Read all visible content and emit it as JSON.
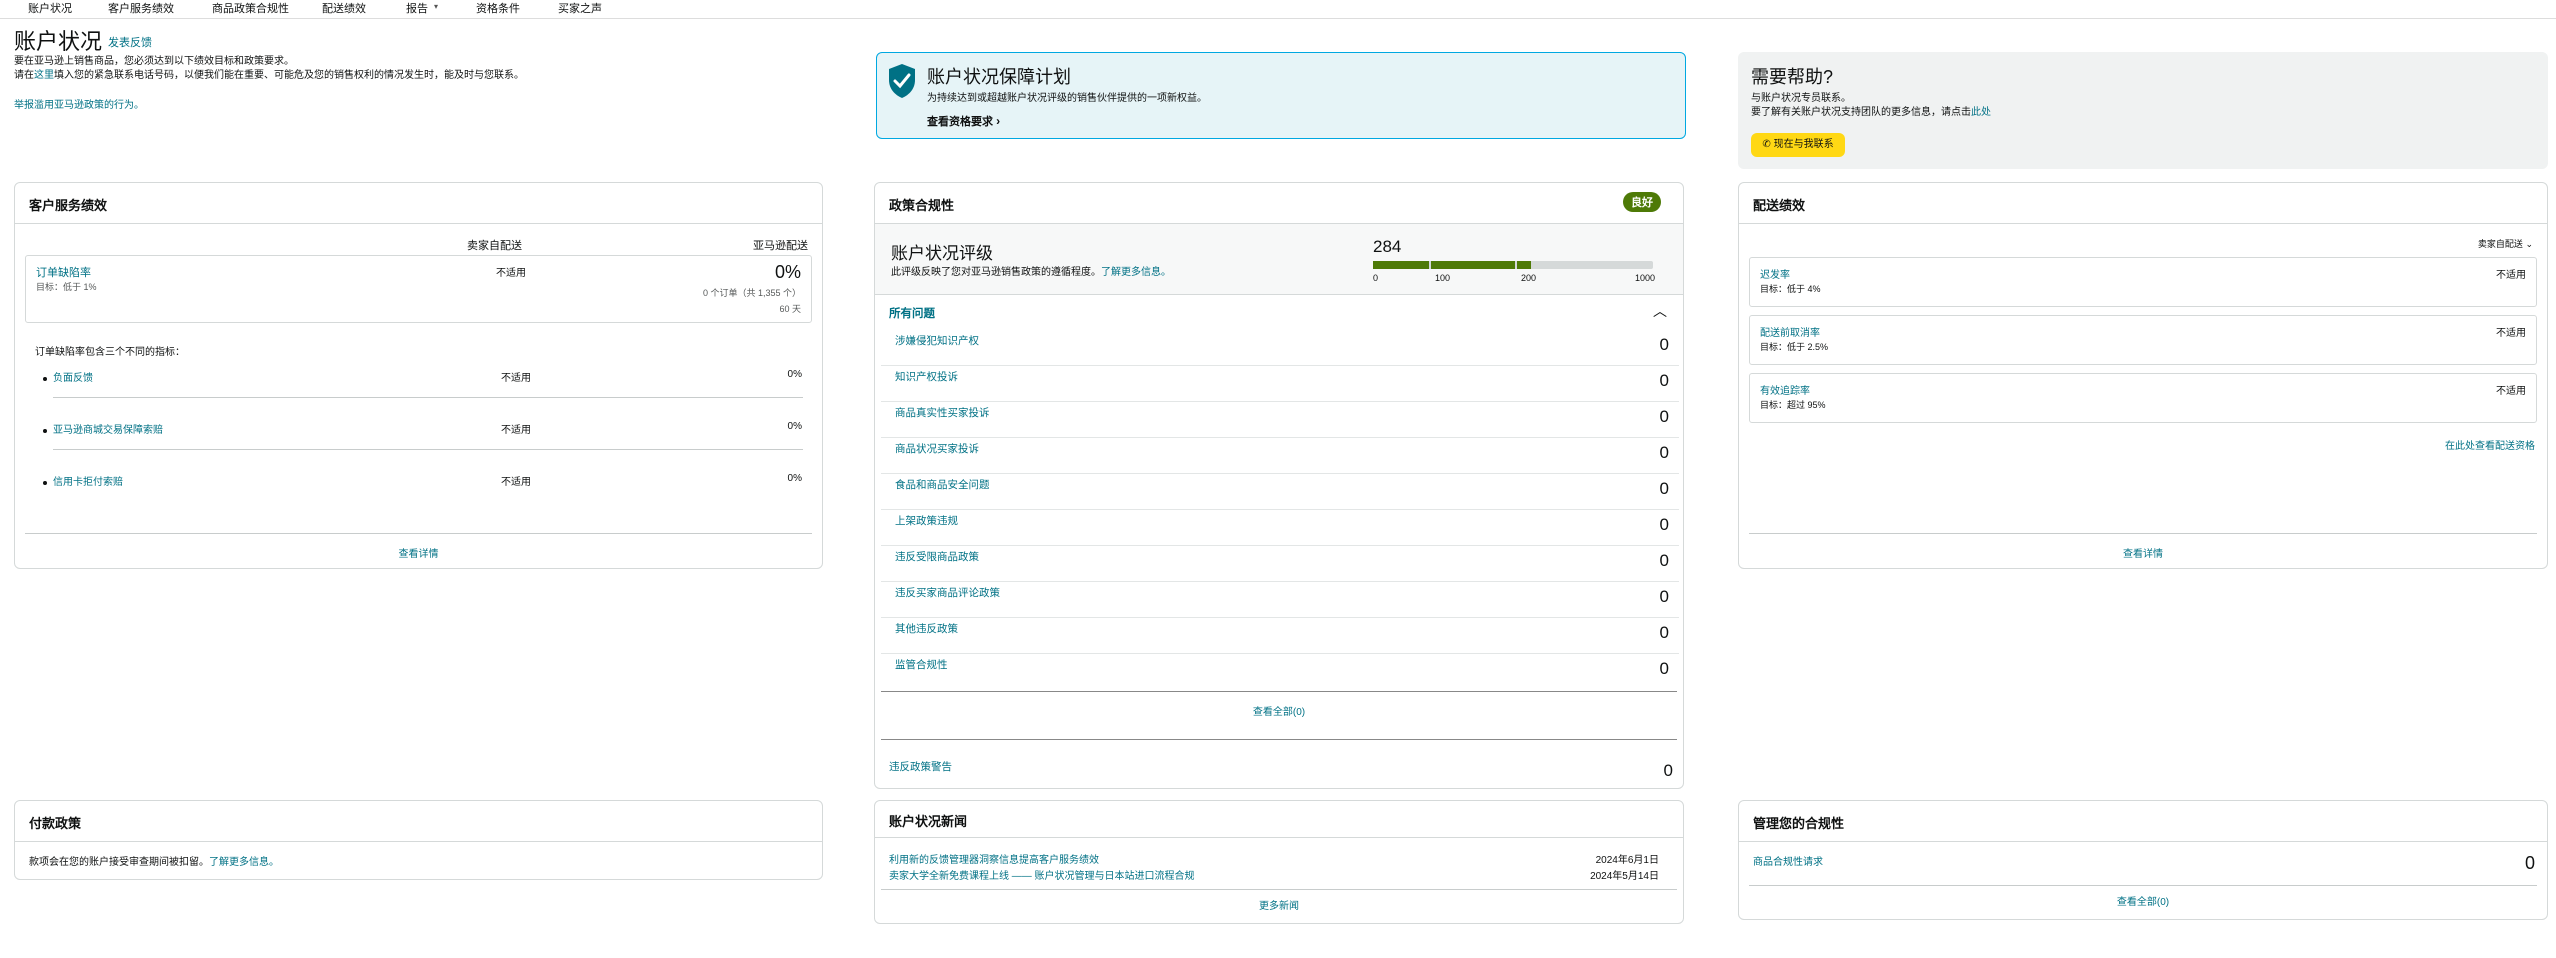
{
  "nav": {
    "items": [
      "账户状况",
      "客户服务绩效",
      "商品政策合规性",
      "配送绩效",
      "报告",
      "资格条件",
      "买家之声"
    ]
  },
  "header": {
    "title": "账户状况",
    "feedback_link": "发表反馈",
    "line1": "要在亚马逊上销售商品，您必须达到以下绩效目标和政策要求。",
    "line2_prefix": "请在",
    "line2_link": "这里",
    "line2_suffix": "填入您的紧急联系电话号码，以便我们能在重要、可能危及您的销售权利的情况发生时，能及时与您联系。",
    "report_link": "举报滥用亚马逊政策的行为。"
  },
  "protection": {
    "title": "账户状况保障计划",
    "desc": "为持续达到或超越账户状况评级的销售伙伴提供的一项新权益。",
    "link": "查看资格要求"
  },
  "help": {
    "title": "需要帮助?",
    "line1": "与账户状况专员联系。",
    "line2_prefix": "要了解有关账户状况支持团队的更多信息，请点击",
    "line2_link": "此处",
    "button": "现在与我联系"
  },
  "customer_service": {
    "title": "客户服务绩效",
    "col1": "卖家自配送",
    "col2": "亚马逊配送",
    "odr_label": "订单缺陷率",
    "odr_target": "目标：低于 1%",
    "odr_mfn": "不适用",
    "odr_afn": "0%",
    "odr_orders": "0 个订单（共 1,355 个）",
    "odr_days": "60 天",
    "breakdown_title": "订单缺陷率包含三个不同的指标：",
    "metrics": [
      {
        "label": "负面反馈",
        "mfn": "不适用",
        "afn": "0%"
      },
      {
        "label": "亚马逊商城交易保障索赔",
        "mfn": "不适用",
        "afn": "0%"
      },
      {
        "label": "信用卡拒付索赔",
        "mfn": "不适用",
        "afn": "0%"
      }
    ],
    "details_link": "查看详情"
  },
  "policy": {
    "title": "政策合规性",
    "badge": "良好",
    "ahr_title": "账户状况评级",
    "ahr_desc": "此评级反映了您对亚马逊销售政策的遵循程度。",
    "ahr_link": "了解更多信息。",
    "score": "284",
    "scale": [
      "0",
      "100",
      "200",
      "1000"
    ],
    "score_fraction": 0.284,
    "issues_title": "所有问题",
    "issues": [
      {
        "label": "涉嫌侵犯知识产权",
        "count": "0"
      },
      {
        "label": "知识产权投诉",
        "count": "0"
      },
      {
        "label": "商品真实性买家投诉",
        "count": "0"
      },
      {
        "label": "商品状况买家投诉",
        "count": "0"
      },
      {
        "label": "食品和商品安全问题",
        "count": "0"
      },
      {
        "label": "上架政策违规",
        "count": "0"
      },
      {
        "label": "违反受限商品政策",
        "count": "0"
      },
      {
        "label": "违反买家商品评论政策",
        "count": "0"
      },
      {
        "label": "其他违反政策",
        "count": "0"
      },
      {
        "label": "监管合规性",
        "count": "0"
      }
    ],
    "view_all": "查看全部(0)",
    "warnings_label": "违反政策警告",
    "warnings_count": "0"
  },
  "shipping": {
    "title": "配送绩效",
    "filter": "卖家自配送",
    "metrics": [
      {
        "label": "迟发率",
        "target": "目标：低于 4%",
        "value": "不适用"
      },
      {
        "label": "配送前取消率",
        "target": "目标：低于 2.5%",
        "value": "不适用"
      },
      {
        "label": "有效追踪率",
        "target": "目标：超过 95%",
        "value": "不适用"
      }
    ],
    "more_link": "在此处查看配送资格",
    "details_link": "查看详情"
  },
  "payment": {
    "title": "付款政策",
    "text": "款项会在您的账户接受审查期间被扣留。",
    "link": "了解更多信息。"
  },
  "news": {
    "title": "账户状况新闻",
    "items": [
      {
        "label": "利用新的反馈管理器洞察信息提高客户服务绩效",
        "date": "2024年6月1日"
      },
      {
        "label": "卖家大学全新免费课程上线 —— 账户状况管理与日本站进口流程合规",
        "date": "2024年5月14日"
      }
    ],
    "more": "更多新闻"
  },
  "compliance": {
    "title": "管理您的合规性",
    "item": "商品合规性请求",
    "count": "0",
    "view_all": "查看全部(0)"
  },
  "colors": {
    "link": "#007185",
    "good": "#4e7a07",
    "banner_bg": "#e6f4f7",
    "banner_border": "#00a8e1",
    "help_bg": "#f0f2f2",
    "button": "#ffd814"
  },
  "icons": [
    "shield-check-icon",
    "chevron-right-icon",
    "phone-icon",
    "chevron-up-icon",
    "chevron-down-icon"
  ]
}
